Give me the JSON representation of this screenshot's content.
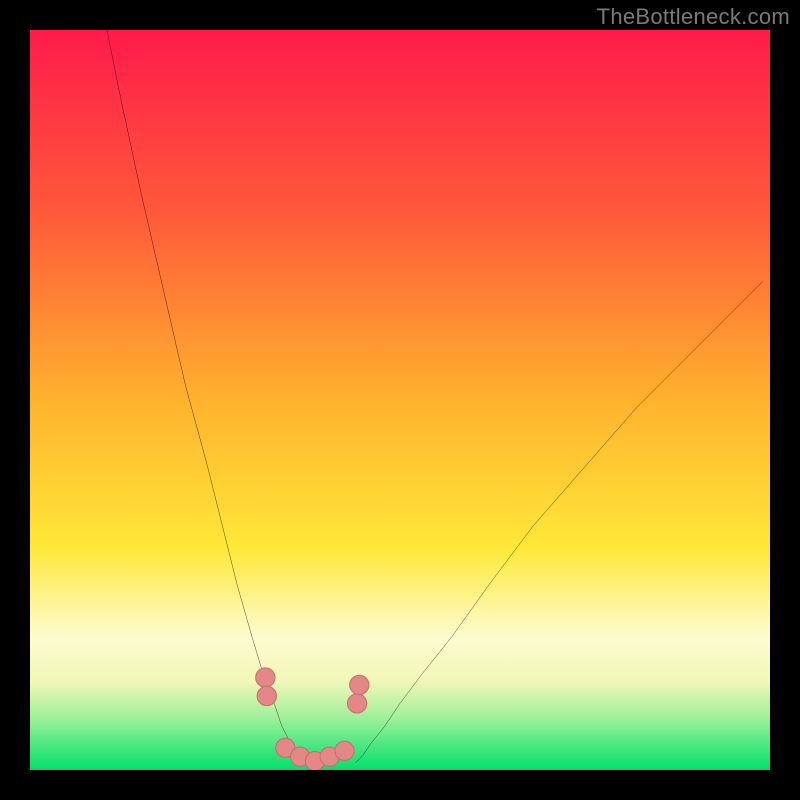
{
  "attribution": "TheBottleneck.com",
  "colors": {
    "gradient_top": "#ff1a4b",
    "gradient_bottom": "#00e06b",
    "marker_fill": "#e38787",
    "marker_stroke": "#c96f6f",
    "curve_stroke": "#000000",
    "attribution_text": "#7a7a7a"
  },
  "chart_data": {
    "type": "line",
    "title": "",
    "xlabel": "",
    "ylabel": "",
    "xlim": [
      0,
      100
    ],
    "ylim": [
      0,
      100
    ],
    "grid": false,
    "series": [
      {
        "name": "left-curve",
        "x": [
          10,
          12,
          15,
          18,
          21,
          24,
          26,
          28,
          30,
          31.5,
          33,
          34,
          35,
          36,
          37,
          38
        ],
        "y": [
          102,
          92,
          78,
          65,
          52,
          41,
          33,
          25,
          18,
          13,
          9,
          6,
          4,
          2.5,
          1.5,
          1
        ]
      },
      {
        "name": "right-curve",
        "x": [
          44,
          45,
          46,
          48,
          50,
          53,
          57,
          62,
          68,
          75,
          82,
          90,
          99
        ],
        "y": [
          1,
          2,
          3.5,
          6,
          9,
          13,
          18,
          25,
          33,
          41,
          49,
          57,
          66
        ]
      },
      {
        "name": "bottleneck-markers",
        "x": [
          31.8,
          32.0,
          34.5,
          36.5,
          38.5,
          40.5,
          42.5,
          44.2,
          44.5
        ],
        "y": [
          12.5,
          10.0,
          3.0,
          1.8,
          1.2,
          1.8,
          2.6,
          9.0,
          11.5
        ]
      }
    ]
  }
}
